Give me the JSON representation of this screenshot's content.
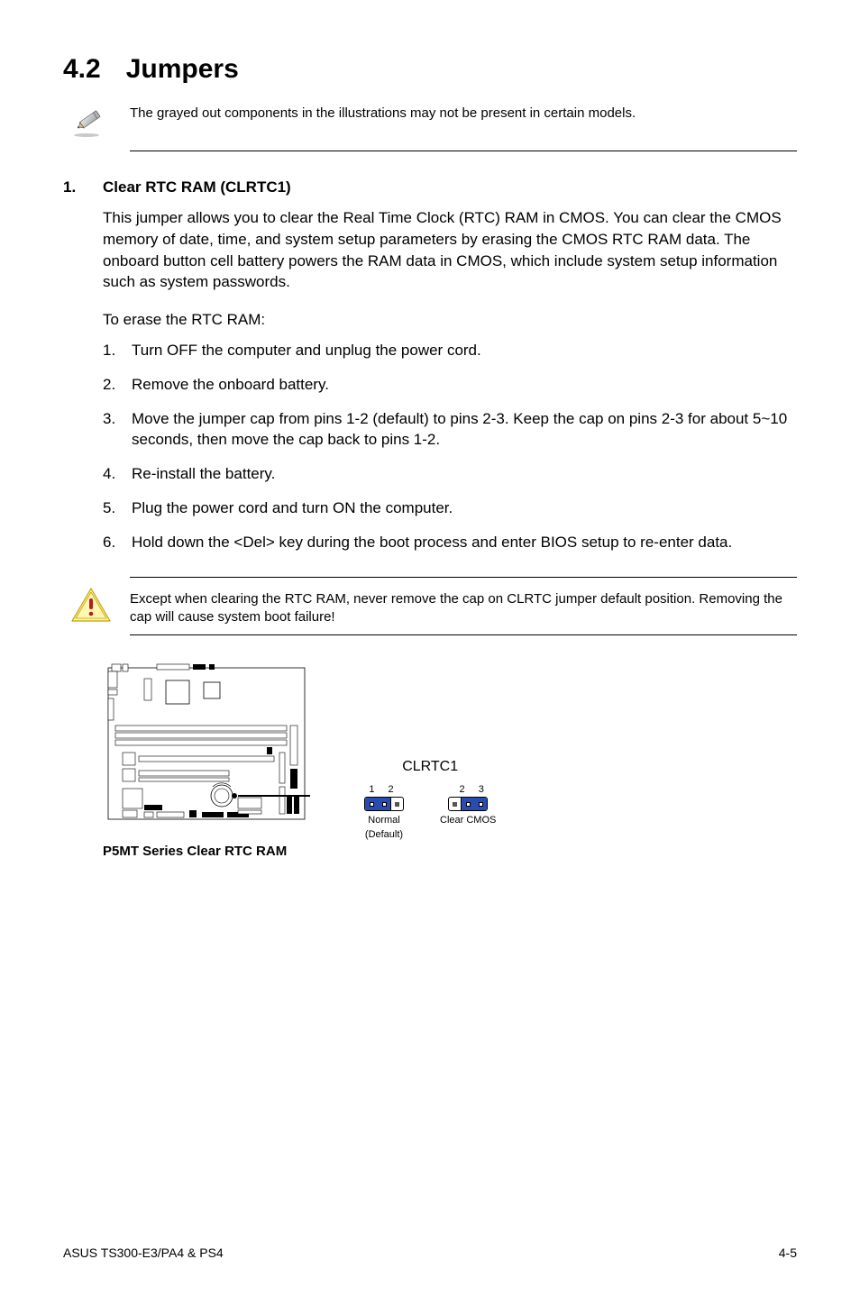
{
  "section": {
    "number": "4.2",
    "title": "Jumpers"
  },
  "pencil_note": "The grayed out components in the illustrations may not be present in certain models.",
  "jumper1": {
    "num": "1.",
    "title": "Clear RTC RAM (CLRTC1)",
    "para": "This jumper allows you to clear the  Real Time Clock (RTC) RAM in CMOS. You can clear the CMOS memory of date, time, and system setup parameters by erasing the CMOS RTC RAM data. The onboard button cell battery powers the RAM data in CMOS, which include system setup information such as system passwords.",
    "erase_lead": "To erase the RTC RAM:",
    "steps": [
      "Turn OFF the computer and unplug the power cord.",
      "Remove the onboard battery.",
      "Move the jumper cap from pins 1-2 (default) to pins 2-3. Keep the cap on pins 2-3 for about 5~10 seconds, then move the cap back to pins  1-2.",
      "Re-install the battery.",
      "Plug the power cord and turn ON the computer.",
      "Hold down the <Del> key during the boot process and enter BIOS setup to re-enter data."
    ]
  },
  "warning": "Except when clearing the RTC RAM, never remove the cap on CLRTC jumper default position. Removing the cap will cause system boot failure!",
  "diagram": {
    "caption": "P5MT Series Clear RTC RAM",
    "jumper_name": "CLRTC1",
    "pos_a": {
      "pins": "1  2",
      "label1": "Normal",
      "label2": "(Default)"
    },
    "pos_b": {
      "pins": "2  3",
      "label1": "Clear CMOS",
      "label2": ""
    }
  },
  "footer": {
    "left": "ASUS TS300-E3/PA4 & PS4",
    "right": "4-5"
  }
}
